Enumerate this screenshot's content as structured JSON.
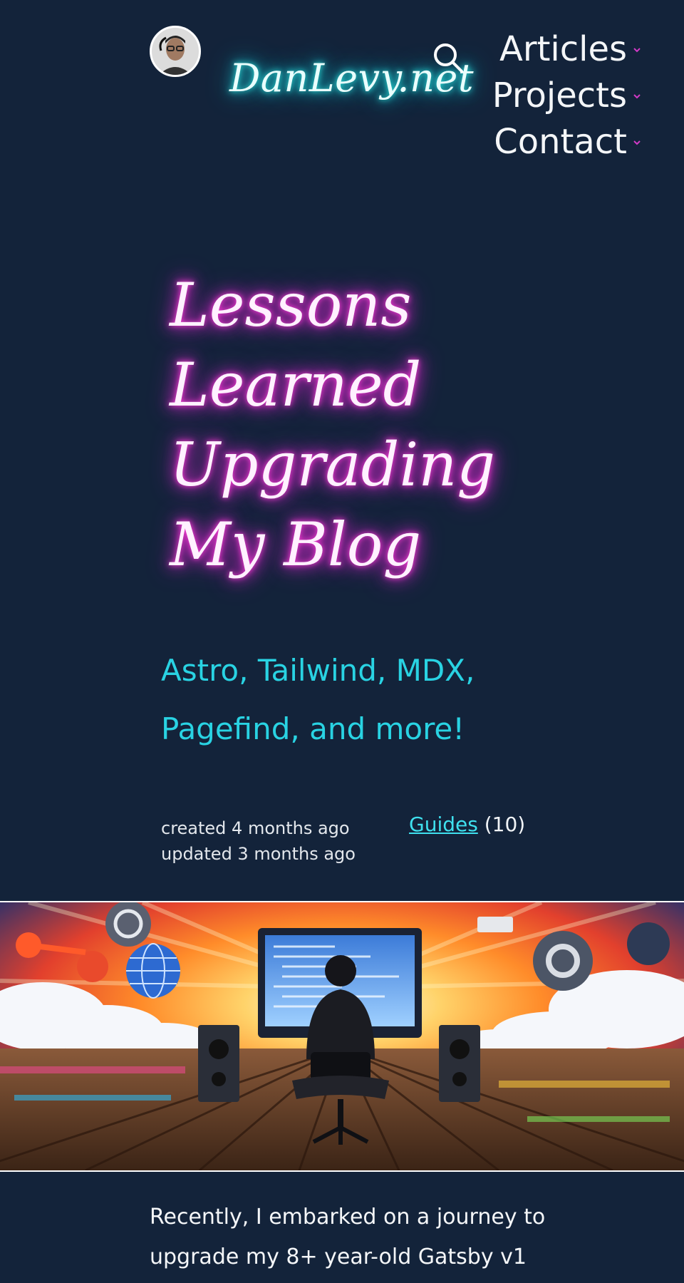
{
  "header": {
    "logo_text": "DanLevy.net",
    "search_icon": "search-icon",
    "nav": [
      {
        "label": "Articles",
        "icon": "chevron-down-icon"
      },
      {
        "label": "Projects",
        "icon": "chevron-down-icon"
      },
      {
        "label": "Contact",
        "icon": "chevron-down-icon"
      }
    ]
  },
  "article": {
    "title": "Lessons Learned Upgrading My Blog",
    "subtitle": "Astro, Tailwind, MDX, Pagefind, and more!",
    "created": "created 4 months ago",
    "updated": "updated 3 months ago",
    "category": {
      "label": "Guides",
      "count": "(10)"
    },
    "body": "Recently, I embarked on a journey to upgrade my 8+ year-old Gatsby v1"
  },
  "colors": {
    "background": "#13233a",
    "logo_glow": "#2ee6df",
    "title_glow": "#e22bd2",
    "subtitle": "#29d3e3",
    "chevron": "#d13ac6",
    "link": "#3fe0ee"
  }
}
